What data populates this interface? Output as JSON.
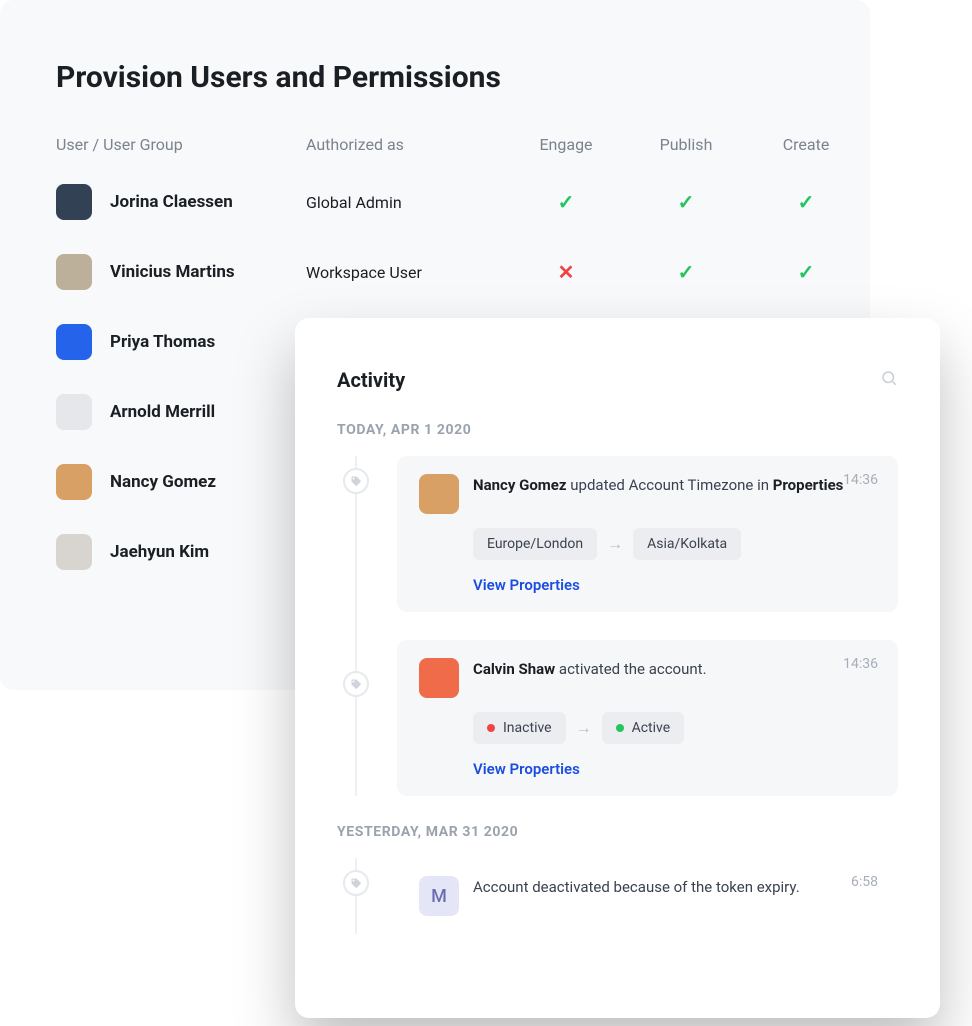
{
  "provision": {
    "title": "Provision Users and Permissions",
    "headers": {
      "user": "User / User Group",
      "auth": "Authorized as",
      "engage": "Engage",
      "publish": "Publish",
      "create": "Create"
    },
    "rows": [
      {
        "name": "Jorina Claessen",
        "role": "Global Admin",
        "avatar_bg": "#334155",
        "perm": {
          "engage": "check",
          "publish": "check",
          "create": "check"
        }
      },
      {
        "name": "Vinicius Martins",
        "role": "Workspace User",
        "avatar_bg": "#bcb09a",
        "perm": {
          "engage": "cross",
          "publish": "check",
          "create": "check"
        }
      },
      {
        "name": "Priya Thomas",
        "role": "",
        "avatar_bg": "#2563eb"
      },
      {
        "name": "Arnold Merrill",
        "role": "",
        "avatar_bg": "#e5e7eb"
      },
      {
        "name": "Nancy Gomez",
        "role": "",
        "avatar_bg": "#d9a066"
      },
      {
        "name": "Jaehyun Kim",
        "role": "",
        "avatar_bg": "#d8d5d0"
      }
    ]
  },
  "activity": {
    "title": "Activity",
    "groups": [
      {
        "label": "TODAY, APR 1 2020",
        "entries": [
          {
            "avatar_bg": "#d9a066",
            "actor": "Nancy Gomez",
            "action_prefix": " updated Account Timezone in ",
            "action_bold": "Properties",
            "time": "14:36",
            "chips": {
              "from": "Europe/London",
              "to": "Asia/Kolkata",
              "type": "plain"
            },
            "link": "View Properties"
          },
          {
            "avatar_bg": "#ef6b4a",
            "actor": "Calvin Shaw",
            "action_prefix": " activated the account.",
            "action_bold": "",
            "time": "14:36",
            "chips": {
              "from": "Inactive",
              "to": "Active",
              "type": "status"
            },
            "link": "View Properties"
          }
        ]
      },
      {
        "label": "YESTERDAY, MAR 31 2020",
        "entries": [
          {
            "avatar_letter": "M",
            "plain_text": "Account deactivated because of the token expiry.",
            "time": "6:58"
          }
        ]
      }
    ]
  }
}
